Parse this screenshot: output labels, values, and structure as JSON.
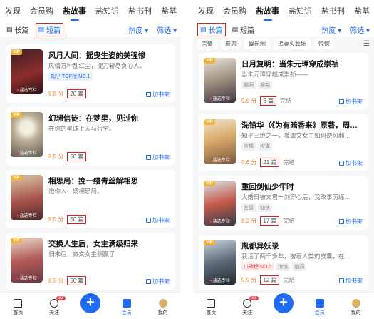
{
  "left": {
    "nav_tabs": [
      "发现",
      "会员购",
      "盐故事",
      "盐知识",
      "盐书刊",
      "盐基"
    ],
    "active_tab_index": 2,
    "length_chips": [
      "长篇",
      "短篇"
    ],
    "active_chip_index": 1,
    "sort_label": "热度 ▾",
    "filter_label": "筛选 ▾",
    "books": [
      {
        "title": "风月人间：摇曳生姿的美强惨",
        "desc": "风情万种乱红尘，提刀斩尽负心人。",
        "badges": [
          "知乎 TOP榜 NO.1"
        ],
        "score": "9.8 分",
        "count": "20 篇",
        "status": "",
        "shelf": "加书架"
      },
      {
        "title": "幻想信徒：在梦里，见过你",
        "desc": "在你的星球上天马行空。",
        "badges": [],
        "score": "8.5 分",
        "count": "50 篇",
        "status": "",
        "shelf": "加书架"
      },
      {
        "title": "相思局：挽一缕青丝解相思",
        "desc": "邀你入一场相思局。",
        "badges": [],
        "score": "8.5 分",
        "count": "50 篇",
        "status": "",
        "shelf": "加书架"
      },
      {
        "title": "交换人生后，女主满级归来",
        "desc": "归来后，爽文女主躺赢了",
        "badges": [],
        "score": "8.5 分",
        "count": "50 篇",
        "status": "",
        "shelf": "加书架"
      }
    ],
    "bottom_nav": {
      "home": "首页",
      "follow": "关注",
      "follow_badge": "83",
      "vip": "会员",
      "me": "我的"
    }
  },
  "right": {
    "nav_tabs": [
      "发现",
      "会员购",
      "盐故事",
      "盐知识",
      "盐书刊",
      "盐基"
    ],
    "active_tab_index": 2,
    "length_chips": [
      "长篇",
      "短篇"
    ],
    "active_chip_index": 0,
    "sort_label": "热度 ▾",
    "filter_label": "筛选 ▾",
    "genre_tags": [
      "言情",
      "虐恋",
      "娱乐圈",
      "追妻火葬场",
      "惊悚"
    ],
    "books": [
      {
        "title": "日月复明：当朱元璋穿成崇祯",
        "desc": "当朱元璋穿越成崇祯——",
        "badges": [
          "脑洞",
          "穿越"
        ],
        "score": "9.6 分",
        "count": "6 篇",
        "status": "完结",
        "shelf": "加书架"
      },
      {
        "title": "洗铅华（《为有暗香来》原著，周…",
        "desc": "知乎三绝之一，看虐文女主如何逆风翻…",
        "badges": [
          "言情",
          "权谋"
        ],
        "score": "9.6 分",
        "count": "21 篇",
        "status": "完结",
        "shelf": "加书架"
      },
      {
        "title": "重回剑仙少年时",
        "desc": "大婚日被夫君一剑穿心后，我改事历练…",
        "badges": [
          "言情",
          "仙侠"
        ],
        "score": "8.2 分",
        "count": "17 篇",
        "status": "完结",
        "shelf": "加书架"
      },
      {
        "title": "胤都异妖录",
        "desc": "我活了两千多年，披着人类的皮囊，在…",
        "badges": [
          "口碑榜 NO.2",
          "惊悚",
          "脑洞"
        ],
        "score": "9.9 分",
        "count": "12 篇",
        "status": "完结",
        "shelf": "加书架"
      }
    ],
    "bottom_nav": {
      "home": "首页",
      "follow": "关注",
      "follow_badge": "83",
      "vip": "会员",
      "me": "我的"
    }
  }
}
